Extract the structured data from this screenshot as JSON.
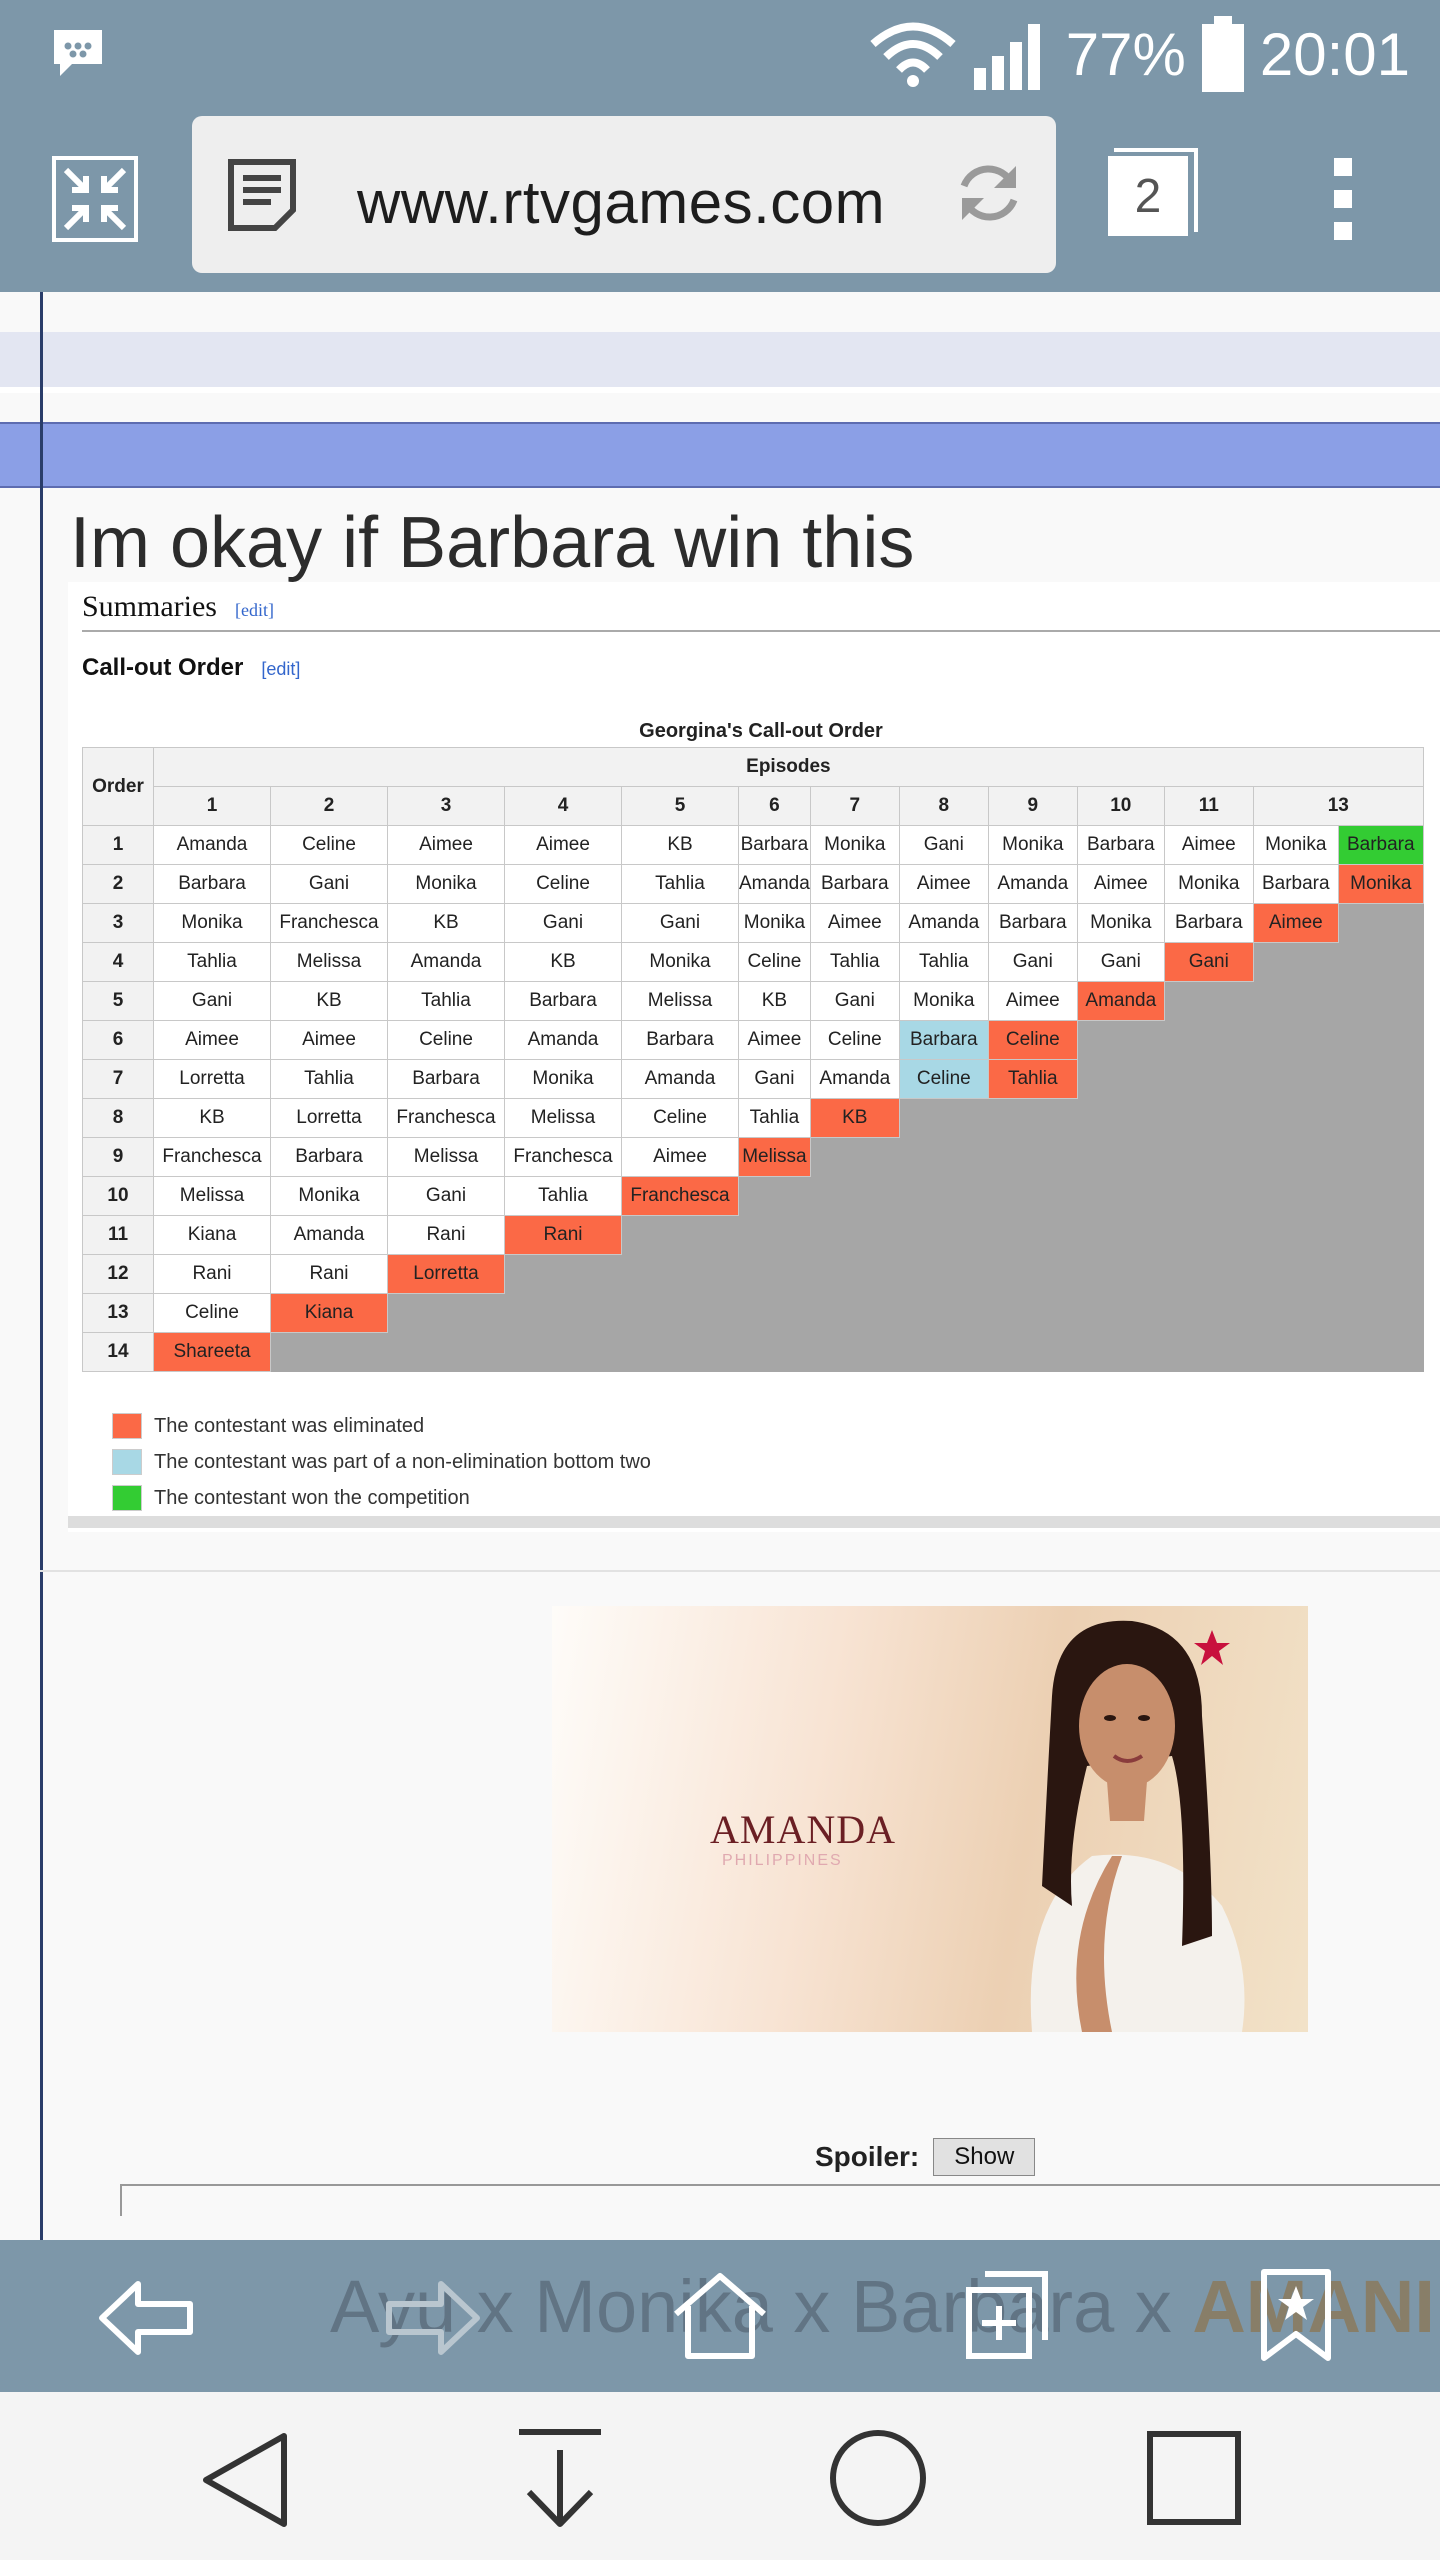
{
  "status": {
    "battery_text": "77%",
    "time": "20:01",
    "icons": [
      "bbm-icon",
      "wifi-icon",
      "signal-icon",
      "battery-icon"
    ]
  },
  "browser": {
    "url": "www.rtvgames.com",
    "tab_count": "2",
    "icons": [
      "minimize-icon",
      "reader-icon",
      "refresh-icon",
      "menu-icon"
    ]
  },
  "post": {
    "title": "Im okay if Barbara win this"
  },
  "wiki": {
    "summaries_heading": "Summaries",
    "callout_heading": "Call-out Order",
    "edit_label": "[edit]",
    "table_caption": "Georgina's Call-out Order",
    "order_header": "Order",
    "episodes_header": "Episodes",
    "episodes": [
      "1",
      "2",
      "3",
      "4",
      "5",
      "6",
      "7",
      "8",
      "9",
      "10",
      "11",
      "13"
    ],
    "rows": [
      {
        "order": "1",
        "cells": [
          [
            "Amanda",
            "n"
          ],
          [
            "Celine",
            "n"
          ],
          [
            "Aimee",
            "n"
          ],
          [
            "Aimee",
            "n"
          ],
          [
            "KB",
            "n"
          ],
          [
            "Barbara",
            "n"
          ],
          [
            "Monika",
            "n"
          ],
          [
            "Gani",
            "n"
          ],
          [
            "Monika",
            "n"
          ],
          [
            "Barbara",
            "n"
          ],
          [
            "Aimee",
            "n"
          ],
          [
            "Monika",
            "n"
          ],
          [
            "Barbara",
            "w"
          ]
        ]
      },
      {
        "order": "2",
        "cells": [
          [
            "Barbara",
            "n"
          ],
          [
            "Gani",
            "n"
          ],
          [
            "Monika",
            "n"
          ],
          [
            "Celine",
            "n"
          ],
          [
            "Tahlia",
            "n"
          ],
          [
            "Amanda",
            "n"
          ],
          [
            "Barbara",
            "n"
          ],
          [
            "Aimee",
            "n"
          ],
          [
            "Amanda",
            "n"
          ],
          [
            "Aimee",
            "n"
          ],
          [
            "Monika",
            "n"
          ],
          [
            "Barbara",
            "n"
          ],
          [
            "Monika",
            "e"
          ]
        ]
      },
      {
        "order": "3",
        "cells": [
          [
            "Monika",
            "n"
          ],
          [
            "Franchesca",
            "n"
          ],
          [
            "KB",
            "n"
          ],
          [
            "Gani",
            "n"
          ],
          [
            "Gani",
            "n"
          ],
          [
            "Monika",
            "n"
          ],
          [
            "Aimee",
            "n"
          ],
          [
            "Amanda",
            "n"
          ],
          [
            "Barbara",
            "n"
          ],
          [
            "Monika",
            "n"
          ],
          [
            "Barbara",
            "n"
          ],
          [
            "Aimee",
            "e"
          ],
          [
            "",
            "g"
          ]
        ]
      },
      {
        "order": "4",
        "cells": [
          [
            "Tahlia",
            "n"
          ],
          [
            "Melissa",
            "n"
          ],
          [
            "Amanda",
            "n"
          ],
          [
            "KB",
            "n"
          ],
          [
            "Monika",
            "n"
          ],
          [
            "Celine",
            "n"
          ],
          [
            "Tahlia",
            "n"
          ],
          [
            "Tahlia",
            "n"
          ],
          [
            "Gani",
            "n"
          ],
          [
            "Gani",
            "n"
          ],
          [
            "Gani",
            "e"
          ],
          [
            "",
            "g"
          ],
          [
            "",
            "g"
          ]
        ]
      },
      {
        "order": "5",
        "cells": [
          [
            "Gani",
            "n"
          ],
          [
            "KB",
            "n"
          ],
          [
            "Tahlia",
            "n"
          ],
          [
            "Barbara",
            "n"
          ],
          [
            "Melissa",
            "n"
          ],
          [
            "KB",
            "n"
          ],
          [
            "Gani",
            "n"
          ],
          [
            "Monika",
            "n"
          ],
          [
            "Aimee",
            "n"
          ],
          [
            "Amanda",
            "e"
          ],
          [
            "",
            "g"
          ],
          [
            "",
            "g"
          ],
          [
            "",
            "g"
          ]
        ]
      },
      {
        "order": "6",
        "cells": [
          [
            "Aimee",
            "n"
          ],
          [
            "Aimee",
            "n"
          ],
          [
            "Celine",
            "n"
          ],
          [
            "Amanda",
            "n"
          ],
          [
            "Barbara",
            "n"
          ],
          [
            "Aimee",
            "n"
          ],
          [
            "Celine",
            "n"
          ],
          [
            "Barbara",
            "b"
          ],
          [
            "Celine",
            "e"
          ],
          [
            "",
            "g"
          ],
          [
            "",
            "g"
          ],
          [
            "",
            "g"
          ],
          [
            "",
            "g"
          ]
        ]
      },
      {
        "order": "7",
        "cells": [
          [
            "Lorretta",
            "n"
          ],
          [
            "Tahlia",
            "n"
          ],
          [
            "Barbara",
            "n"
          ],
          [
            "Monika",
            "n"
          ],
          [
            "Amanda",
            "n"
          ],
          [
            "Gani",
            "n"
          ],
          [
            "Amanda",
            "n"
          ],
          [
            "Celine",
            "b"
          ],
          [
            "Tahlia",
            "e"
          ],
          [
            "",
            "g"
          ],
          [
            "",
            "g"
          ],
          [
            "",
            "g"
          ],
          [
            "",
            "g"
          ]
        ]
      },
      {
        "order": "8",
        "cells": [
          [
            "KB",
            "n"
          ],
          [
            "Lorretta",
            "n"
          ],
          [
            "Franchesca",
            "n"
          ],
          [
            "Melissa",
            "n"
          ],
          [
            "Celine",
            "n"
          ],
          [
            "Tahlia",
            "n"
          ],
          [
            "KB",
            "e"
          ],
          [
            "",
            "g"
          ],
          [
            "",
            "g"
          ],
          [
            "",
            "g"
          ],
          [
            "",
            "g"
          ],
          [
            "",
            "g"
          ],
          [
            "",
            "g"
          ]
        ]
      },
      {
        "order": "9",
        "cells": [
          [
            "Franchesca",
            "n"
          ],
          [
            "Barbara",
            "n"
          ],
          [
            "Melissa",
            "n"
          ],
          [
            "Franchesca",
            "n"
          ],
          [
            "Aimee",
            "n"
          ],
          [
            "Melissa",
            "e"
          ],
          [
            "",
            "g"
          ],
          [
            "",
            "g"
          ],
          [
            "",
            "g"
          ],
          [
            "",
            "g"
          ],
          [
            "",
            "g"
          ],
          [
            "",
            "g"
          ],
          [
            "",
            "g"
          ]
        ]
      },
      {
        "order": "10",
        "cells": [
          [
            "Melissa",
            "n"
          ],
          [
            "Monika",
            "n"
          ],
          [
            "Gani",
            "n"
          ],
          [
            "Tahlia",
            "n"
          ],
          [
            "Franchesca",
            "e"
          ],
          [
            "",
            "g"
          ],
          [
            "",
            "g"
          ],
          [
            "",
            "g"
          ],
          [
            "",
            "g"
          ],
          [
            "",
            "g"
          ],
          [
            "",
            "g"
          ],
          [
            "",
            "g"
          ],
          [
            "",
            "g"
          ]
        ]
      },
      {
        "order": "11",
        "cells": [
          [
            "Kiana",
            "n"
          ],
          [
            "Amanda",
            "n"
          ],
          [
            "Rani",
            "n"
          ],
          [
            "Rani",
            "e"
          ],
          [
            "",
            "g"
          ],
          [
            "",
            "g"
          ],
          [
            "",
            "g"
          ],
          [
            "",
            "g"
          ],
          [
            "",
            "g"
          ],
          [
            "",
            "g"
          ],
          [
            "",
            "g"
          ],
          [
            "",
            "g"
          ],
          [
            "",
            "g"
          ]
        ]
      },
      {
        "order": "12",
        "cells": [
          [
            "Rani",
            "n"
          ],
          [
            "Rani",
            "n"
          ],
          [
            "Lorretta",
            "e"
          ],
          [
            "",
            "g"
          ],
          [
            "",
            "g"
          ],
          [
            "",
            "g"
          ],
          [
            "",
            "g"
          ],
          [
            "",
            "g"
          ],
          [
            "",
            "g"
          ],
          [
            "",
            "g"
          ],
          [
            "",
            "g"
          ],
          [
            "",
            "g"
          ],
          [
            "",
            "g"
          ]
        ]
      },
      {
        "order": "13",
        "cells": [
          [
            "Celine",
            "n"
          ],
          [
            "Kiana",
            "e"
          ],
          [
            "",
            "g"
          ],
          [
            "",
            "g"
          ],
          [
            "",
            "g"
          ],
          [
            "",
            "g"
          ],
          [
            "",
            "g"
          ],
          [
            "",
            "g"
          ],
          [
            "",
            "g"
          ],
          [
            "",
            "g"
          ],
          [
            "",
            "g"
          ],
          [
            "",
            "g"
          ],
          [
            "",
            "g"
          ]
        ]
      },
      {
        "order": "14",
        "cells": [
          [
            "Shareeta",
            "e"
          ],
          [
            "",
            "g"
          ],
          [
            "",
            "g"
          ],
          [
            "",
            "g"
          ],
          [
            "",
            "g"
          ],
          [
            "",
            "g"
          ],
          [
            "",
            "g"
          ],
          [
            "",
            "g"
          ],
          [
            "",
            "g"
          ],
          [
            "",
            "g"
          ],
          [
            "",
            "g"
          ],
          [
            "",
            "g"
          ],
          [
            "",
            "g"
          ]
        ]
      }
    ],
    "legend": [
      {
        "color": "#fb6946",
        "label": "The contestant was eliminated"
      },
      {
        "color": "#a8d8e5",
        "label": "The contestant was part of a non-elimination bottom two"
      },
      {
        "color": "#33cc33",
        "label": "The contestant won the competition"
      }
    ]
  },
  "image": {
    "name": "AMANDA",
    "subtitle": "PHILIPPINES"
  },
  "spoiler": {
    "label": "Spoiler:",
    "button": "Show"
  },
  "bottom_bar": {
    "ghost_text_plain": "Ayu x Monika x Barbara x ",
    "ghost_text_bold": "AMANI",
    "icons": [
      "back-icon",
      "forward-icon",
      "home-icon",
      "new-tab-icon",
      "bookmark-icon"
    ]
  },
  "navbar": {
    "icons": [
      "nav-back-icon",
      "nav-down-icon",
      "nav-home-icon",
      "nav-recents-icon"
    ]
  },
  "colors": {
    "chrome": "#7d97a9",
    "eliminated": "#fb6946",
    "bottom_two": "#a8d8e5",
    "winner": "#33cc33"
  }
}
